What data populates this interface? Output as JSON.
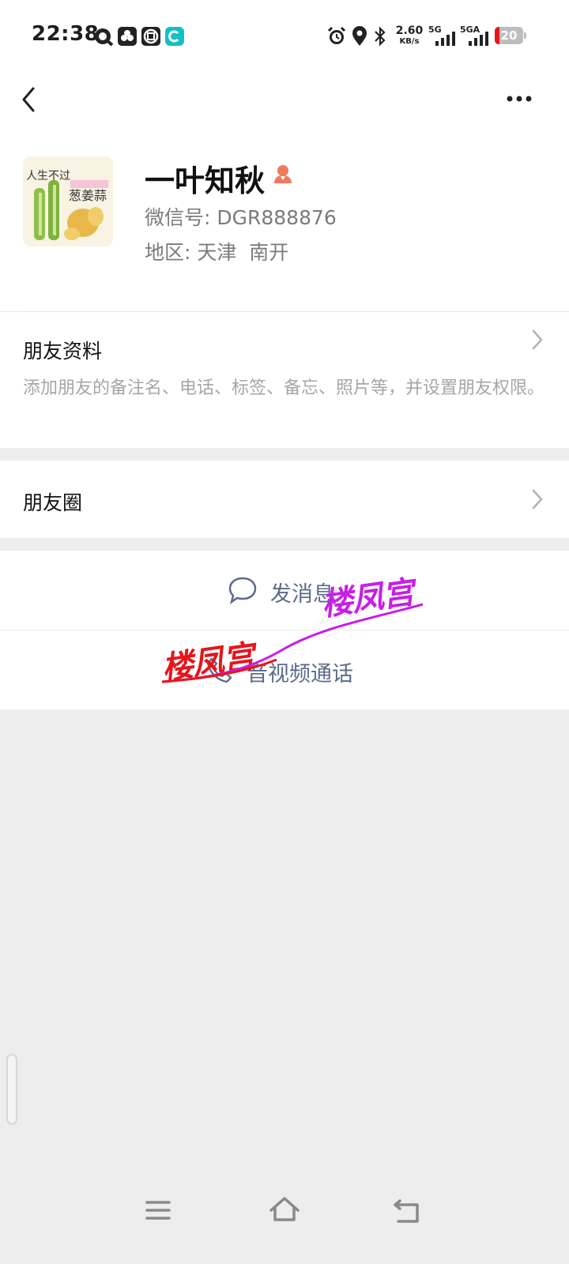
{
  "status_bar": {
    "time": "22:38",
    "network_speed": "2.60",
    "network_unit": "KB/s",
    "signal1_label": "5G",
    "signal2_label": "5GA",
    "battery": "20",
    "icons": [
      "alarm-icon",
      "location-icon",
      "bluetooth-icon"
    ]
  },
  "nav": {
    "back_icon": "chevron-left-icon",
    "more_icon": "more-icon"
  },
  "profile": {
    "name": "一叶知秋",
    "gender_icon": "female-icon",
    "wechat_id": "微信号: DGR888876",
    "region": "地区: 天津  南开",
    "avatar_text_line1": "人生不过",
    "avatar_text_line2": "葱姜蒜"
  },
  "friend_info": {
    "title": "朋友资料",
    "subtitle": "添加朋友的备注名、电话、标签、备忘、照片等，并设置朋友权限。"
  },
  "moments": {
    "title": "朋友圈"
  },
  "actions": {
    "message": "发消息",
    "call": "音视频通话"
  },
  "watermarks": {
    "text1": "楼凤宫",
    "text2": "楼凤宫"
  },
  "colors": {
    "accent_text": "#5c6b8a",
    "background": "#ededed",
    "gender_icon": "#f07a5b",
    "watermark_red": "#e8141b",
    "watermark_purple": "#c81ee8"
  }
}
